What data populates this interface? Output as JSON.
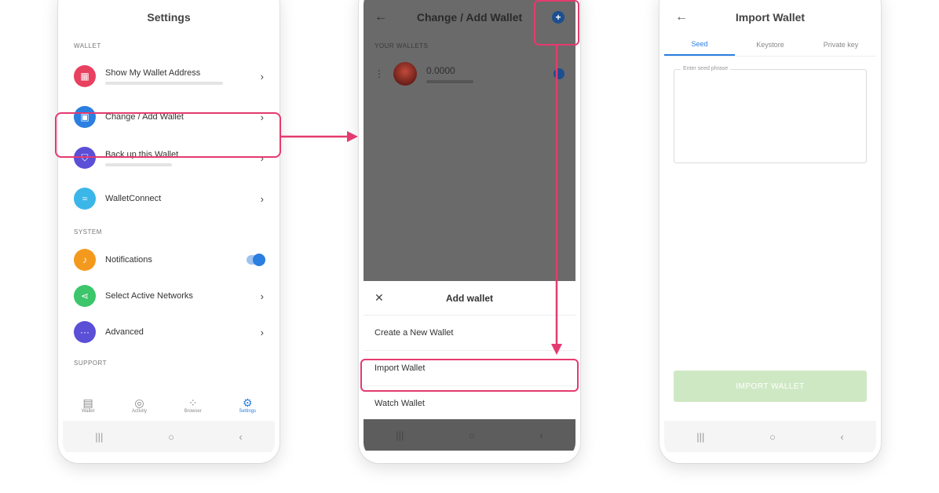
{
  "colors": {
    "highlight": "#e53a6f",
    "accent": "#2a7fe0"
  },
  "phone1": {
    "title": "Settings",
    "sections": {
      "wallet": "WALLET",
      "system": "SYSTEM",
      "support": "SUPPORT"
    },
    "items": [
      {
        "label": "Show My Wallet Address",
        "icon": "qr-icon",
        "color": "#e8415f"
      },
      {
        "label": "Change / Add Wallet",
        "icon": "wallet-icon",
        "color": "#2a7fe0"
      },
      {
        "label": "Back up this Wallet",
        "icon": "shield-icon",
        "color": "#5a4fd6"
      },
      {
        "label": "WalletConnect",
        "icon": "walletconnect-icon",
        "color": "#3bb6e8"
      },
      {
        "label": "Notifications",
        "icon": "bell-icon",
        "color": "#f39a1e"
      },
      {
        "label": "Select Active Networks",
        "icon": "share-icon",
        "color": "#3cc56a"
      },
      {
        "label": "Advanced",
        "icon": "more-icon",
        "color": "#5a4fd6"
      }
    ],
    "nav": [
      {
        "label": "Wallet",
        "icon": "wallet-icon"
      },
      {
        "label": "Activity",
        "icon": "activity-icon"
      },
      {
        "label": "Browser",
        "icon": "browser-icon"
      },
      {
        "label": "Settings",
        "icon": "gear-icon"
      }
    ]
  },
  "phone2": {
    "title": "Change / Add Wallet",
    "section": "YOUR WALLETS",
    "wallet_balance": "0.0000",
    "sheet_title": "Add wallet",
    "sheet_items": [
      "Create a New Wallet",
      "Import Wallet",
      "Watch Wallet"
    ]
  },
  "phone3": {
    "title": "Import Wallet",
    "tabs": [
      "Seed",
      "Keystore",
      "Private key"
    ],
    "seed_label": "Enter seed phrase",
    "button": "IMPORT WALLET"
  }
}
